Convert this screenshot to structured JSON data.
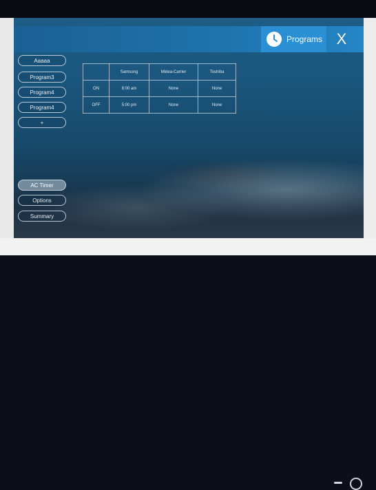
{
  "header": {
    "title": "Programs",
    "close_label": "X"
  },
  "sidebar": {
    "programs": [
      "Aaaaa",
      "Program3",
      "Program4",
      "Program4",
      "+"
    ],
    "bottom": [
      "AC Timer",
      "Options",
      "Summary"
    ]
  },
  "table": {
    "header": [
      "",
      "Samsung",
      "Midea-Carrier",
      "Toshiba"
    ],
    "rows": [
      [
        "ON",
        "8:00 am",
        "None",
        "None"
      ],
      [
        "OFF",
        "5:00 pm",
        "None",
        "None"
      ]
    ]
  },
  "colors": {
    "accent": "#2b8fd3",
    "topbar": "#1f73ad"
  },
  "icons": {
    "title_icon": "clock-icon",
    "close_icon": "close-icon"
  }
}
